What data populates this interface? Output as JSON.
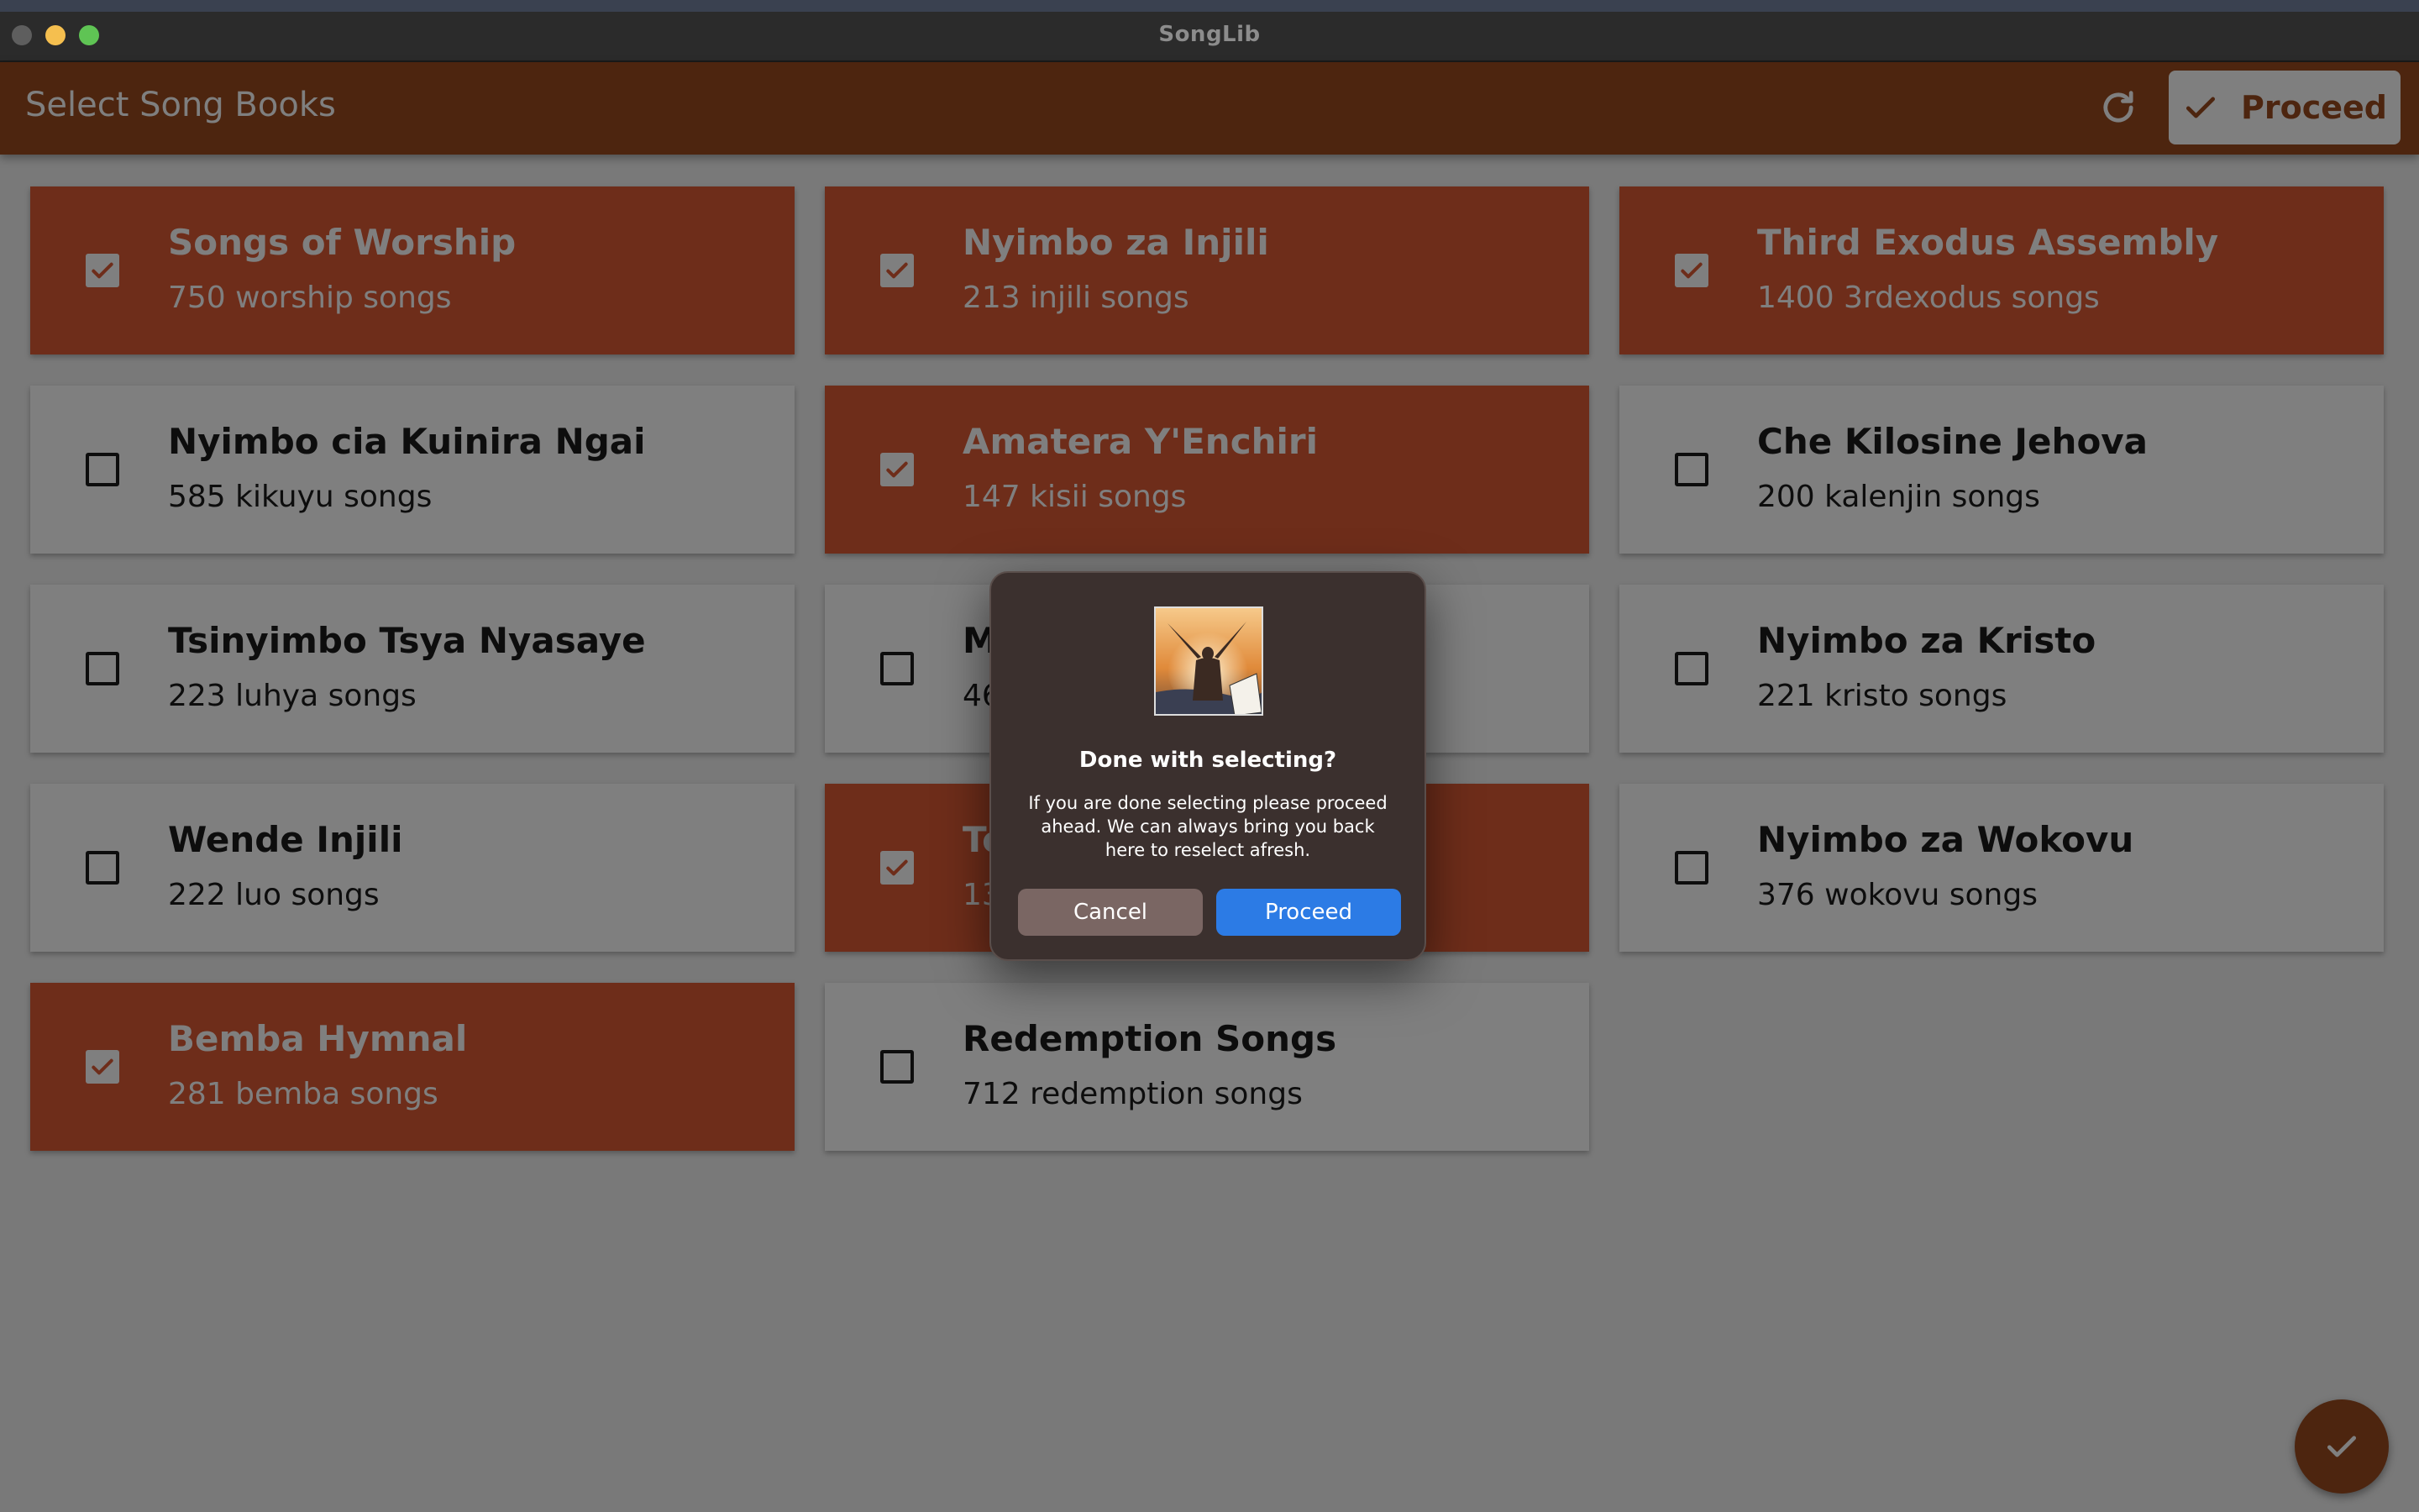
{
  "window": {
    "title": "SongLib"
  },
  "appbar": {
    "title": "Select Song Books",
    "refresh_icon": "refresh-icon",
    "proceed_label": "Proceed"
  },
  "books": [
    {
      "title": "Songs of Worship",
      "subtitle": "750 worship songs",
      "selected": true
    },
    {
      "title": "Nyimbo za Injili",
      "subtitle": "213 injili songs",
      "selected": true
    },
    {
      "title": "Third Exodus Assembly",
      "subtitle": "1400 3rdexodus songs",
      "selected": true
    },
    {
      "title": "Nyimbo cia Kuinira Ngai",
      "subtitle": "585 kikuyu songs",
      "selected": false
    },
    {
      "title": "Amatera Y'Enchiri",
      "subtitle": "147 kisii songs",
      "selected": true
    },
    {
      "title": "Che Kilosine Jehova",
      "subtitle": "200 kalenjin songs",
      "selected": false
    },
    {
      "title": "Tsinyimbo Tsya Nyasaye",
      "subtitle": "223 luhya songs",
      "selected": false
    },
    {
      "title": "M",
      "subtitle": "46",
      "selected": false
    },
    {
      "title": "Nyimbo za Kristo",
      "subtitle": "221 kristo songs",
      "selected": false
    },
    {
      "title": "Wende Injili",
      "subtitle": "222 luo songs",
      "selected": false
    },
    {
      "title": "To",
      "subtitle": "13",
      "selected": true
    },
    {
      "title": "Nyimbo za Wokovu",
      "subtitle": "376 wokovu songs",
      "selected": false
    },
    {
      "title": "Bemba Hymnal",
      "subtitle": "281 bemba songs",
      "selected": true
    },
    {
      "title": "Redemption Songs",
      "subtitle": "712 redemption songs",
      "selected": false
    }
  ],
  "dialog": {
    "title": "Done with selecting?",
    "message": "If you are done selecting please proceed ahead. We can always bring you back here to reselect afresh.",
    "cancel_label": "Cancel",
    "proceed_label": "Proceed"
  },
  "colors": {
    "accent": "#9a4a1f",
    "selected_card": "#dd5a34",
    "dialog_primary": "#2c7be5"
  }
}
